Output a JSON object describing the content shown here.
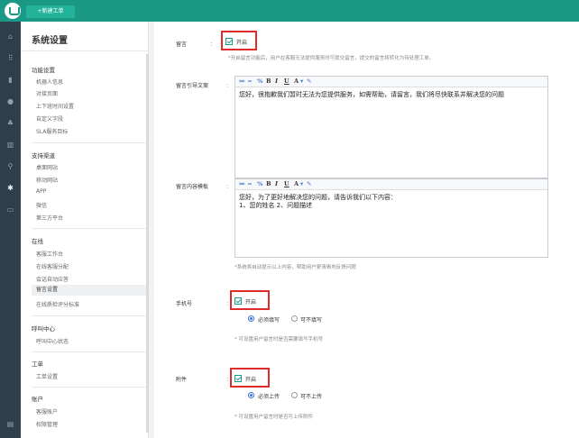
{
  "header": {
    "new_ticket": "+新建工单"
  },
  "rail": {
    "icons": [
      "home-icon",
      "grid-icon",
      "book-icon",
      "person-icon",
      "people-icon",
      "chart-icon",
      "search-icon",
      "gear-icon",
      "chat-icon",
      "message-icon"
    ]
  },
  "sidebar": {
    "title": "系统设置",
    "sections": [
      {
        "title": "功能设置",
        "items": [
          "机器人信息",
          "对接页面",
          "上下班时间设置",
          "自定义字段",
          "SLA服务目标"
        ]
      },
      {
        "title": "支持渠道",
        "items": [
          "桌面网站",
          "移动网站",
          "APP",
          "微信",
          "第三方平台"
        ]
      },
      {
        "title": "在线",
        "items": [
          "客服工作台",
          "在线客服分配",
          "会话自动应答",
          "留言设置",
          "在线质检评分标准"
        ]
      },
      {
        "title": "呼叫中心",
        "items": [
          "呼叫中心状态"
        ]
      },
      {
        "title": "工单",
        "items": [
          "工单设置"
        ]
      },
      {
        "title": "账户",
        "items": [
          "客服账户",
          "权限管理"
        ]
      }
    ],
    "active_item": "留言设置"
  },
  "form": {
    "colon": "：",
    "leave_msg": {
      "label": "留言",
      "checkbox": "开启",
      "hint": "*开启留言功能后，用户在客服无法提供服务时可提交留言，提交的留言将转化为待处理工单。"
    },
    "guide_text": {
      "label": "留言引导文案",
      "content": "您好，很抱歉我们暂时无法为您提供服务，如需帮助，请留言，我们将尽快联系并解决您的问题"
    },
    "template": {
      "label": "留言内容模板",
      "content": "您好，为了更好地解决您的问题，请告诉我们以下内容：\n1、您的姓名 2、问题描述",
      "hint": "*系统将自动提示以上内容，帮助用户更清晰地反馈问题"
    },
    "phone": {
      "label": "手机号",
      "checkbox": "开启",
      "required": "必须填写",
      "optional": "可不填写",
      "hint": "* 可设置用户留言时是否需要填写手机号"
    },
    "attachment": {
      "label": "附件",
      "checkbox": "开启",
      "required": "必须上传",
      "optional": "可不上传",
      "hint": "* 可设置用户留言时是否可上传附件"
    },
    "toolbar": {
      "bold": "B",
      "italic": "I",
      "underline": "U",
      "font": "A"
    }
  }
}
